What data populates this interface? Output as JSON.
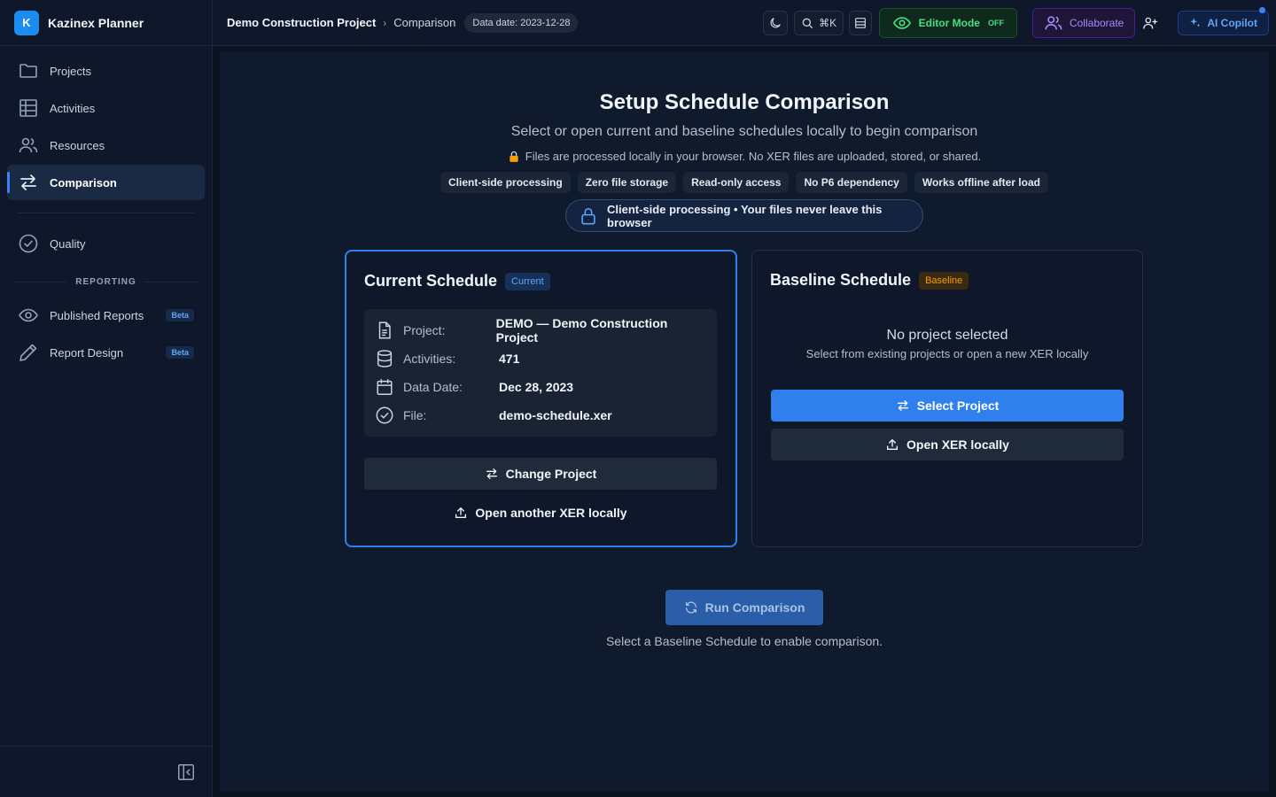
{
  "app": {
    "logo_letter": "K",
    "name": "Kazinex Planner"
  },
  "sidebar": {
    "items": [
      {
        "label": "Projects"
      },
      {
        "label": "Activities"
      },
      {
        "label": "Resources"
      },
      {
        "label": "Comparison",
        "active": true
      },
      {
        "label": "Quality"
      }
    ],
    "section_label": "REPORTING",
    "reporting_items": [
      {
        "label": "Published Reports",
        "badge": "Beta"
      },
      {
        "label": "Report Design",
        "badge": "Beta"
      }
    ]
  },
  "header": {
    "breadcrumb": [
      "Demo Construction Project",
      "Comparison"
    ],
    "breadcrumb_sep": "›",
    "data_date": "Data date: 2023-12-28",
    "search_shortcut": "⌘K",
    "editor_label": "Editor Mode",
    "editor_state": "OFF",
    "collaborate_label": "Collaborate",
    "copilot_label": "AI Copilot"
  },
  "main": {
    "title": "Setup Schedule Comparison",
    "subtitle": "Select or open current and baseline schedules locally to begin comparison",
    "privacy_note": "Files are processed locally in your browser. No XER files are uploaded, stored, or shared.",
    "chips": [
      "Client-side processing",
      "Zero file storage",
      "Read-only access",
      "No P6 dependency",
      "Works offline after load"
    ],
    "lock_banner": "Client-side processing • Your files never leave this browser",
    "current": {
      "title": "Current Schedule",
      "tag": "Current",
      "rows": [
        {
          "label": "Project:",
          "value": "DEMO — Demo Construction Project"
        },
        {
          "label": "Activities:",
          "value": "471"
        },
        {
          "label": "Data Date:",
          "value": "Dec 28, 2023"
        },
        {
          "label": "File:",
          "value": "demo-schedule.xer"
        }
      ],
      "change_btn": "Change Project",
      "open_btn": "Open another XER locally"
    },
    "baseline": {
      "title": "Baseline Schedule",
      "tag": "Baseline",
      "empty_title": "No project selected",
      "empty_sub": "Select from existing projects or open a new XER locally",
      "select_btn": "Select Project",
      "open_btn": "Open XER locally"
    },
    "run_btn": "Run Comparison",
    "run_hint": "Select a Baseline Schedule to enable comparison."
  },
  "colors": {
    "accent": "#2f80ed",
    "editor": "#4ade80",
    "collab": "#a78bfa",
    "baseline_tag": "#f59e0b"
  }
}
